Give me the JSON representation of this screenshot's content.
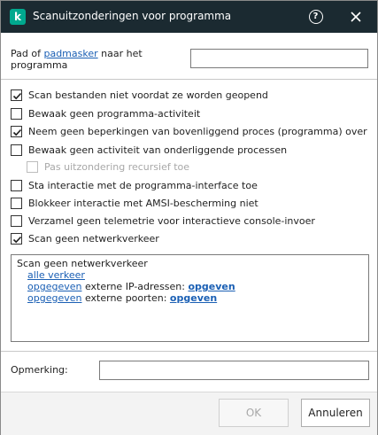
{
  "window": {
    "title": "Scanuitzonderingen voor programma",
    "help_glyph": "?",
    "logo_glyph": "k"
  },
  "path": {
    "label_prefix": "Pad of ",
    "label_link": "padmasker",
    "label_suffix": " naar het programma",
    "value": ""
  },
  "options": [
    {
      "label": "Scan bestanden niet voordat ze worden geopend",
      "checked": true,
      "disabled": false
    },
    {
      "label": "Bewaak geen programma-activiteit",
      "checked": false,
      "disabled": false
    },
    {
      "label": "Neem geen beperkingen van bovenliggend proces (programma) over",
      "checked": true,
      "disabled": false
    },
    {
      "label": "Bewaak geen activiteit van onderliggende processen",
      "checked": false,
      "disabled": false
    },
    {
      "label": "Pas uitzondering recursief toe",
      "checked": false,
      "disabled": true
    },
    {
      "label": "Sta interactie met de programma-interface toe",
      "checked": false,
      "disabled": false
    },
    {
      "label": "Blokkeer interactie met AMSI-bescherming niet",
      "checked": false,
      "disabled": false
    },
    {
      "label": "Verzamel geen telemetrie voor interactieve console-invoer",
      "checked": false,
      "disabled": false
    },
    {
      "label": "Scan geen netwerkverkeer",
      "checked": true,
      "disabled": false
    }
  ],
  "description": {
    "title": "Scan geen netwerkverkeer",
    "traffic_link": "alle verkeer",
    "ip_link": "opgegeven",
    "ip_text": " externe IP-adressen: ",
    "ip_value_link": "opgeven",
    "port_link": "opgegeven",
    "port_text": " externe poorten: ",
    "port_value_link": "opgeven"
  },
  "remark": {
    "label": "Opmerking:",
    "value": ""
  },
  "footer": {
    "ok_label": "OK",
    "ok_disabled": true,
    "cancel_label": "Annuleren"
  },
  "colors": {
    "titlebar": "#1b2a31",
    "logo": "#00a88e",
    "link": "#1a5fb4"
  }
}
